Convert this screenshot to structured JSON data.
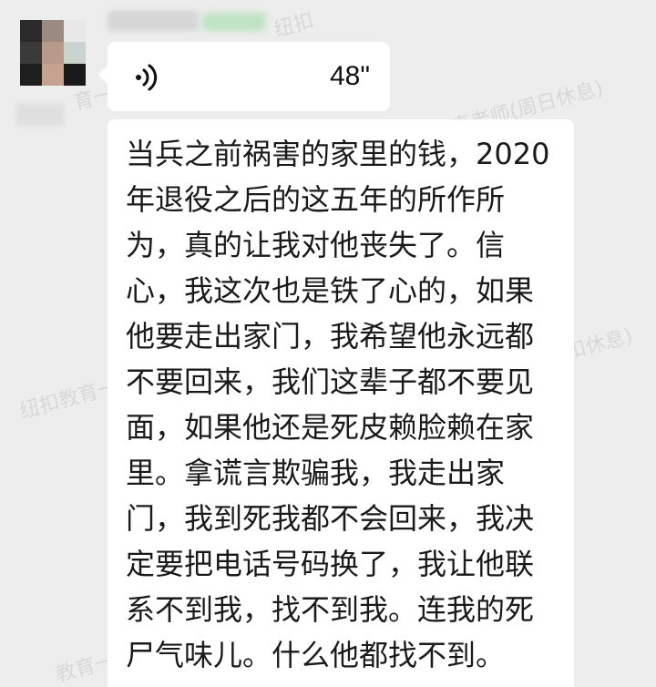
{
  "chat": {
    "voice_message": {
      "duration": "48\""
    },
    "text_message": {
      "lines": [
        "当兵之前祸害的家里的钱，2020",
        "年退役之后的这五年的所作所",
        "为，真的让我对他丧失了。信",
        "心，我这次也是铁了心的，如果",
        "他要走出家门，我希望他永远都",
        "不要回来，我们这辈子都不要见",
        "面，如果他还是死皮赖脸赖在家",
        "里。拿谎言欺骗我，我走出家",
        "门，我到死我都不会回来，我决",
        "定要把电话号码换了，我让他联",
        "系不到我，找不到我。连我的死",
        "尸气味儿。什么他都找不到。"
      ]
    }
  },
  "colors": {
    "background": "#ededed",
    "bubble": "#ffffff",
    "text": "#1a1a1a"
  },
  "icons": {
    "voice": "voice-wave-icon"
  }
}
